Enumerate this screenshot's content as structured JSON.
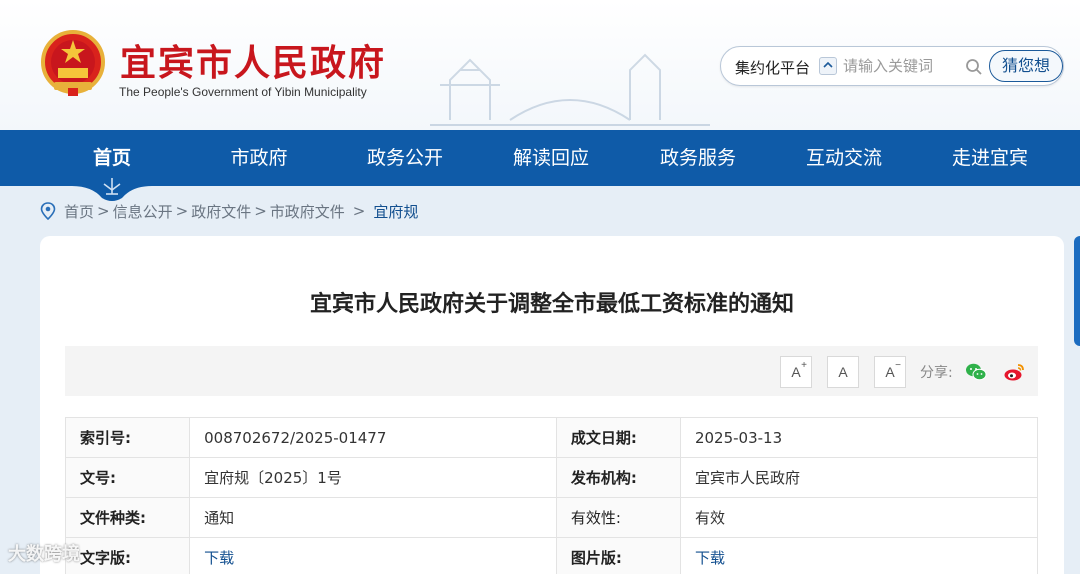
{
  "header": {
    "title": "宜宾市人民政府",
    "subtitle": "The People's Government of Yibin Municipality",
    "emblem_icon": "national-emblem-icon",
    "brand_red": "#c8161d"
  },
  "search": {
    "platform_label": "集约化平台",
    "placeholder": "请输入关键词",
    "guess_label": "猜您想"
  },
  "nav": {
    "color": "#0f5ba8",
    "items": [
      {
        "label": "首页",
        "active": true
      },
      {
        "label": "市政府"
      },
      {
        "label": "政务公开"
      },
      {
        "label": "解读回应"
      },
      {
        "label": "政务服务"
      },
      {
        "label": "互动交流"
      },
      {
        "label": "走进宜宾"
      }
    ]
  },
  "breadcrumb": {
    "items": [
      "首页",
      "信息公开",
      "政府文件",
      "市政府文件",
      "宜府规"
    ],
    "separator": ">"
  },
  "document": {
    "title": "宜宾市人民政府关于调整全市最低工资标准的通知",
    "font_tools": {
      "larger": "A",
      "normal": "A",
      "smaller": "A",
      "plus": "+",
      "minus": "−"
    },
    "share_label": "分享:"
  },
  "info": {
    "rows": [
      [
        {
          "k": "索引号:",
          "v": "008702672/2025-01477"
        },
        {
          "k": "成文日期:",
          "v": "2025-03-13"
        }
      ],
      [
        {
          "k": "文号:",
          "v": "宜府规〔2025〕1号"
        },
        {
          "k": "发布机构:",
          "v": "宜宾市人民政府"
        }
      ],
      [
        {
          "k": "文件种类:",
          "v": "通知"
        },
        {
          "k": "有效性:",
          "v": "有效"
        }
      ],
      [
        {
          "k": "文字版:",
          "v": "下载"
        },
        {
          "k": "图片版:",
          "v": "下载"
        }
      ]
    ]
  },
  "watermark": "大数跨境"
}
